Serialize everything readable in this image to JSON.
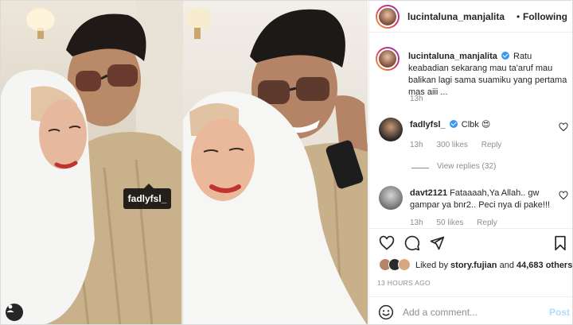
{
  "post": {
    "photo_tag": "fadlyfsl_",
    "author": "lucintaluna_manjalita",
    "follow_separator": "•",
    "follow_label": "Following"
  },
  "comments": [
    {
      "user": "lucintaluna_manjalita",
      "verified": true,
      "text": "Ratu keabadian sekarang mau ta'aruf mau balikan lagi sama suamiku yang pertama mas aiii ...",
      "time": "13h"
    },
    {
      "user": "fadlyfsl_",
      "verified": true,
      "text": "Clbk 😍",
      "time": "13h",
      "likes": "300 likes",
      "reply_label": "Reply",
      "view_replies": "View replies (32)"
    },
    {
      "user": "davt2121",
      "verified": false,
      "text": "Fataaaah,Ya Allah.. gw gampar ya bnr2.. Peci nya di pake!!!",
      "time": "13h",
      "likes": "50 likes",
      "reply_label": "Reply"
    }
  ],
  "likes": {
    "prefix": "Liked by",
    "user": "story.fujian",
    "connector": "and",
    "others": "44,683 others"
  },
  "time_ago": "13 HOURS AGO",
  "add_comment": {
    "placeholder": "Add a comment...",
    "post_label": "Post"
  },
  "colors": {
    "accent": "#3897f0",
    "post_disabled": "#b3dbff",
    "secondary_text": "#8e8e8e",
    "border": "#efefef"
  },
  "icons": [
    "heart-icon",
    "comment-icon",
    "share-icon",
    "bookmark-icon",
    "emoji-icon",
    "verified-icon",
    "user-tag-icon"
  ]
}
